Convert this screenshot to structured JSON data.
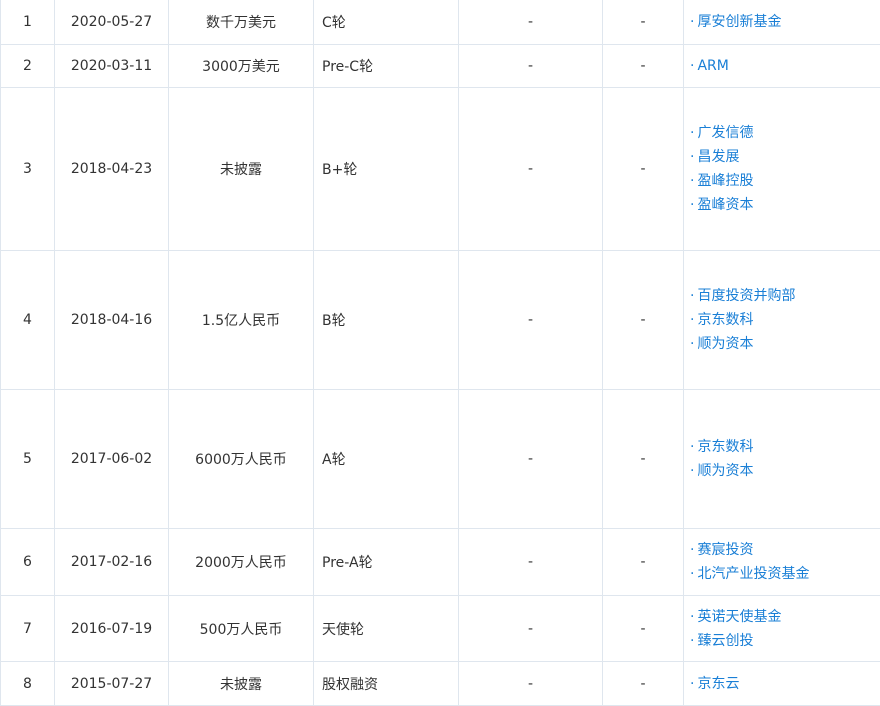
{
  "funding_rounds": [
    {
      "idx": "1",
      "date": "2020-05-27",
      "amount": "数千万美元",
      "round": "C轮",
      "col5": "-",
      "col6": "-",
      "investors": [
        "厚安创新基金"
      ]
    },
    {
      "idx": "2",
      "date": "2020-03-11",
      "amount": "3000万美元",
      "round": "Pre-C轮",
      "col5": "-",
      "col6": "-",
      "investors": [
        "ARM"
      ]
    },
    {
      "idx": "3",
      "date": "2018-04-23",
      "amount": "未披露",
      "round": "B+轮",
      "col5": "-",
      "col6": "-",
      "investors": [
        "广发信德",
        "昌发展",
        "盈峰控股",
        "盈峰资本"
      ]
    },
    {
      "idx": "4",
      "date": "2018-04-16",
      "amount": "1.5亿人民币",
      "round": "B轮",
      "col5": "-",
      "col6": "-",
      "investors": [
        "百度投资并购部",
        "京东数科",
        "顺为资本"
      ]
    },
    {
      "idx": "5",
      "date": "2017-06-02",
      "amount": "6000万人民币",
      "round": "A轮",
      "col5": "-",
      "col6": "-",
      "investors": [
        "京东数科",
        "顺为资本"
      ]
    },
    {
      "idx": "6",
      "date": "2017-02-16",
      "amount": "2000万人民币",
      "round": "Pre-A轮",
      "col5": "-",
      "col6": "-",
      "investors": [
        "赛宸投资",
        "北汽产业投资基金"
      ]
    },
    {
      "idx": "7",
      "date": "2016-07-19",
      "amount": "500万人民币",
      "round": "天使轮",
      "col5": "-",
      "col6": "-",
      "investors": [
        "英诺天使基金",
        "臻云创投"
      ]
    },
    {
      "idx": "8",
      "date": "2015-07-27",
      "amount": "未披露",
      "round": "股权融资",
      "col5": "-",
      "col6": "-",
      "investors": [
        "京东云"
      ]
    }
  ],
  "bullet": "·",
  "colors": {
    "link": "#1a7fd6",
    "border": "#dfe6ee",
    "text": "#333333"
  }
}
